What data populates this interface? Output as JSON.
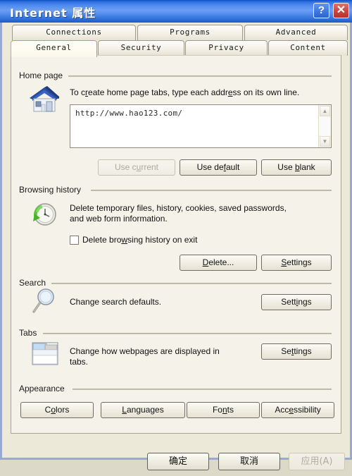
{
  "window": {
    "title": "Internet 属性",
    "help_button": "?",
    "close_button": "✕"
  },
  "tabs": {
    "row1": [
      {
        "label": "Connections",
        "selected": false
      },
      {
        "label": "Programs",
        "selected": false
      },
      {
        "label": "Advanced",
        "selected": false
      }
    ],
    "row2": [
      {
        "label": "General",
        "selected": true
      },
      {
        "label": "Security",
        "selected": false
      },
      {
        "label": "Privacy",
        "selected": false
      },
      {
        "label": "Content",
        "selected": false
      }
    ]
  },
  "home_page": {
    "group_label": "Home page",
    "icon": "house-icon",
    "description_before": "To c",
    "description_accel1": "r",
    "description_mid": "eate home page tabs, type each addr",
    "description_accel2": "e",
    "description_after": "ss on its own line.",
    "textarea_value": "http://www.hao123.com/",
    "scroll_up": "▲",
    "scroll_down": "▼",
    "buttons": [
      {
        "label": "Use current",
        "accel": "c",
        "disabled": true
      },
      {
        "label": "Use default",
        "accel": "f",
        "disabled": false
      },
      {
        "label": "Use blank",
        "accel": "b",
        "disabled": false
      }
    ]
  },
  "browsing_history": {
    "group_label": "Browsing history",
    "icon": "history-clock-icon",
    "description_line1": "Delete temporary files, history, cookies, saved passwords,",
    "description_line2": "and web form information.",
    "checkbox": {
      "label_before": "Delete bro",
      "label_accel": "w",
      "label_after": "sing history on exit",
      "checked": false
    },
    "buttons": [
      {
        "label": "Delete...",
        "accel": "D",
        "disabled": false
      },
      {
        "label": "Settings",
        "accel": "S",
        "disabled": false
      }
    ]
  },
  "search": {
    "group_label": "Search",
    "icon": "magnifier-icon",
    "description": "Change search defaults.",
    "button": {
      "label": "Settings",
      "accel": "i",
      "disabled": false
    }
  },
  "tabs_section": {
    "group_label": "Tabs",
    "icon": "browser-tabs-icon",
    "description_line1": "Change how webpages are displayed in",
    "description_line2": "tabs.",
    "button": {
      "label": "Settings",
      "accel": "t",
      "disabled": false
    }
  },
  "appearance": {
    "group_label": "Appearance",
    "buttons": [
      {
        "label": "Colors",
        "accel": "o",
        "disabled": false
      },
      {
        "label": "Languages",
        "accel": "L",
        "disabled": false
      },
      {
        "label": "Fonts",
        "accel": "n",
        "disabled": false
      },
      {
        "label": "Accessibility",
        "accel": "e",
        "disabled": false
      }
    ]
  },
  "dialog_buttons": [
    {
      "label": "确定",
      "disabled": false
    },
    {
      "label": "取消",
      "disabled": false
    },
    {
      "label": "应用(A)",
      "disabled": true
    }
  ],
  "colors": {
    "titlebar_blue": "#2f6fe0",
    "close_red": "#c8463c",
    "dialog_face": "#ece9d8",
    "panel_face": "#f4f2e9",
    "desktop": "#dcd9c8"
  }
}
